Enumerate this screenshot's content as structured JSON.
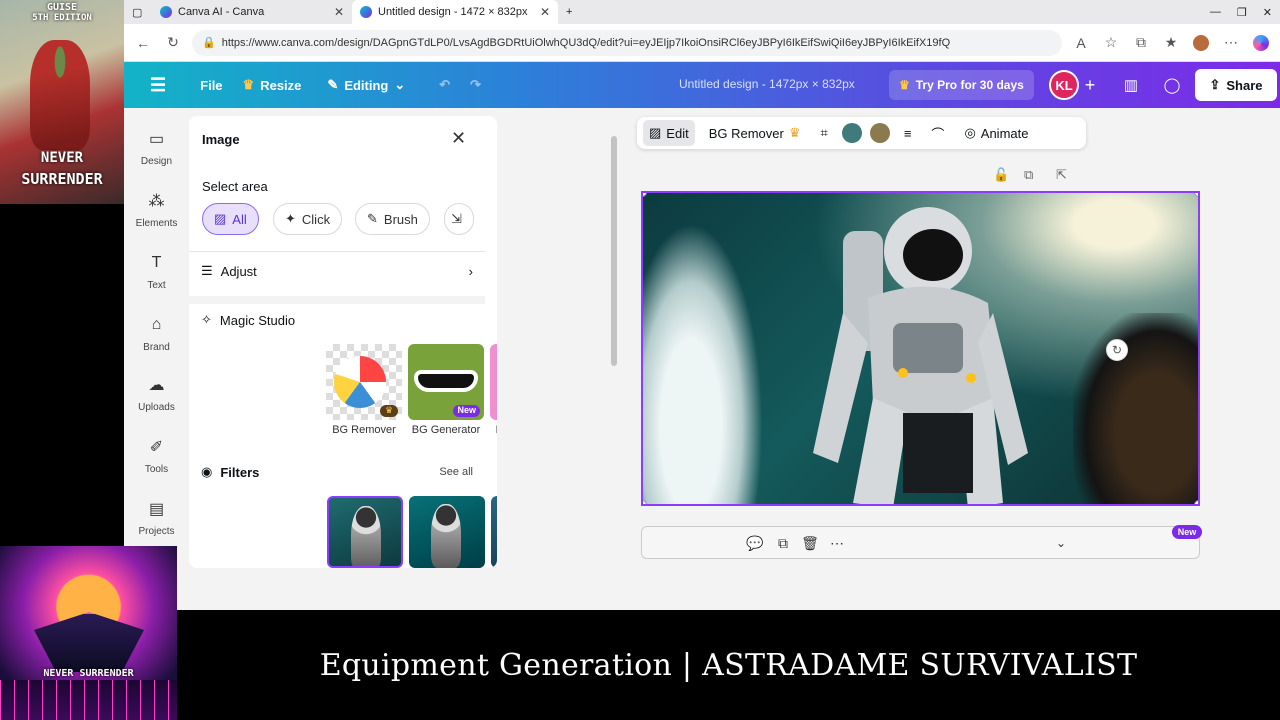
{
  "overlay": {
    "top_art_text_1": "GUISE",
    "top_art_text_2": "5TH EDITION",
    "top_art_text_3": "NEVER",
    "top_art_text_4": "SURRENDER",
    "bottom_art_text": "NEVER SURRENDER",
    "caption": "Equipment Generation | ASTRADAME SURVIVALIST"
  },
  "browser": {
    "tabs": [
      {
        "label": "Canva AI - Canva"
      },
      {
        "label": "Untitled design - 1472 × 832px"
      }
    ],
    "url": "https://www.canva.com/design/DAGpnGTdLP0/LvsAgdBGDRtUiOlwhQU3dQ/edit?ui=eyJEIjp7IkoiOnsiRCl6eyJBPyI6IkEifSwiQiI6eyJBPyI6IkEifX19fQ"
  },
  "header": {
    "file": "File",
    "resize": "Resize",
    "editing": "Editing",
    "title": "Untitled design - 1472px × 832px",
    "try_pro": "Try Pro for 30 days",
    "avatar": "KL",
    "share": "Share"
  },
  "rail": {
    "items": [
      {
        "label": "Design"
      },
      {
        "label": "Elements"
      },
      {
        "label": "Text"
      },
      {
        "label": "Brand"
      },
      {
        "label": "Uploads"
      },
      {
        "label": "Tools"
      },
      {
        "label": "Projects"
      }
    ]
  },
  "panel": {
    "title": "Image",
    "select_area": "Select area",
    "chips": [
      "All",
      "Click",
      "Brush"
    ],
    "adjust": "Adjust",
    "magic_studio": "Magic Studio",
    "tools": [
      {
        "label": "BG Remover"
      },
      {
        "label": "BG Generator",
        "badge": "New"
      },
      {
        "label": "Magic Eraser"
      },
      {
        "label": "M"
      }
    ],
    "filters": "Filters",
    "see_all": "See all"
  },
  "toolbar": {
    "edit": "Edit",
    "bg_remover": "BG Remover",
    "animate": "Animate",
    "colors": [
      "#3f7a7d",
      "#8b7a50"
    ]
  },
  "canvas": {
    "new_badge": "New"
  }
}
